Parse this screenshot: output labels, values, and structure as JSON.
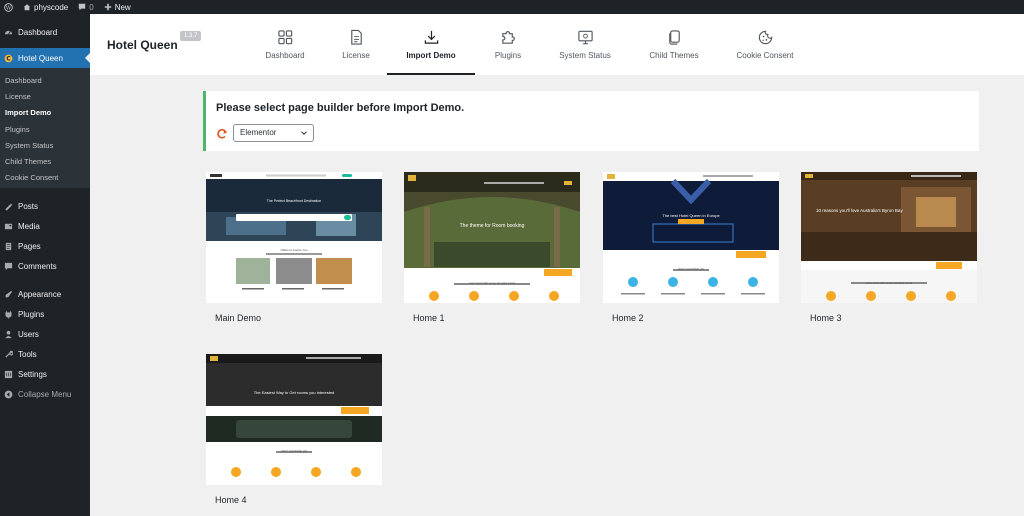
{
  "admin_bar": {
    "site_name": "physcode",
    "comments_count": "0",
    "new_label": "New"
  },
  "sidebar": {
    "dashboard": "Dashboard",
    "plugin_menu": "Hotel Queen",
    "submenu": [
      "Dashboard",
      "License",
      "Import Demo",
      "Plugins",
      "System Status",
      "Child Themes",
      "Cookie Consent"
    ],
    "current_sub_index": 2,
    "items": [
      "Posts",
      "Media",
      "Pages",
      "Comments",
      "Appearance",
      "Plugins",
      "Users",
      "Tools",
      "Settings"
    ],
    "collapse": "Collapse Menu",
    "accent_color": "#2271b1"
  },
  "header": {
    "brand": "Hotel Queen",
    "version": "1.3.7",
    "tabs": [
      {
        "label": "Dashboard",
        "icon": "grid-icon"
      },
      {
        "label": "License",
        "icon": "document-icon"
      },
      {
        "label": "Import Demo",
        "icon": "download-icon"
      },
      {
        "label": "Plugins",
        "icon": "puzzle-icon"
      },
      {
        "label": "System Status",
        "icon": "monitor-icon"
      },
      {
        "label": "Child Themes",
        "icon": "layers-icon"
      },
      {
        "label": "Cookie Consent",
        "icon": "cookie-icon"
      }
    ],
    "active_tab": "Import Demo"
  },
  "notice": {
    "message": "Please select page builder before Import Demo.",
    "builder_value": "Elementor",
    "border_color": "#4ab866"
  },
  "demos": [
    {
      "label": "Main Demo",
      "headline": "The Perfect Beachfront Destination",
      "section": "Offers to inspire You"
    },
    {
      "label": "Home 1",
      "headline": "The theme for Room booking",
      "section": "Let's start with some benefits Hotel"
    },
    {
      "label": "Home 2",
      "headline": "The best Hotel Queen in Europe",
      "section": "WHY CHOOSE US"
    },
    {
      "label": "Home 3",
      "headline": "10 reasons you'll love Australia's Byron Bay",
      "section": "Let's start with some benefits Hotel"
    },
    {
      "label": "Home 4",
      "headline": "The Easiest Way to Get rooms you interested",
      "section": "WHY CHOOSE US"
    }
  ]
}
